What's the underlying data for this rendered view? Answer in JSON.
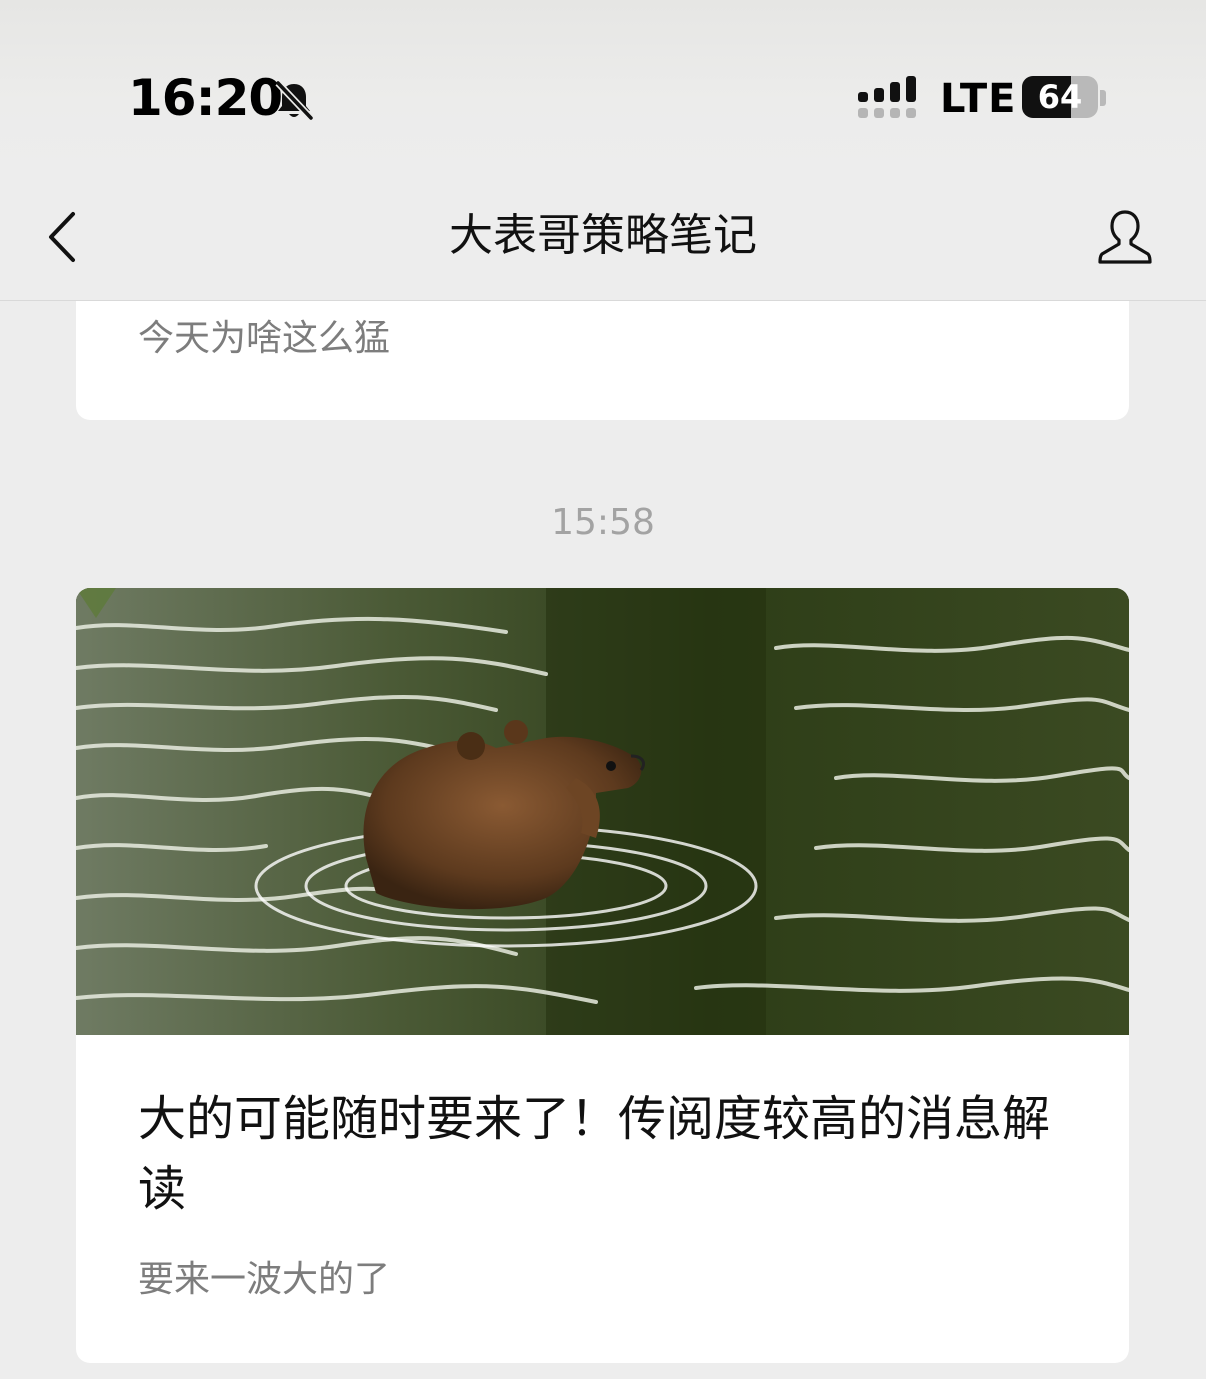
{
  "status_bar": {
    "time": "16:20",
    "network": "LTE",
    "battery_percent": "64",
    "bell_icon": "bell-slash-icon",
    "signal_icon": "signal-icon"
  },
  "nav": {
    "title": "大表哥策略笔记",
    "back_icon": "chevron-left-icon",
    "profile_icon": "person-icon"
  },
  "messages": {
    "previous_card": {
      "summary": "今天为啥这么猛"
    },
    "timestamp": "15:58",
    "article_card": {
      "image_icon": "bear-in-water-image",
      "title": "大的可能随时要来了！传阅度较高的消息解读",
      "summary": "要来一波大的了"
    }
  },
  "colors": {
    "background": "#ededed",
    "card": "#ffffff",
    "muted_text": "#7d7d7d",
    "timestamp_text": "#a3a3a3"
  }
}
